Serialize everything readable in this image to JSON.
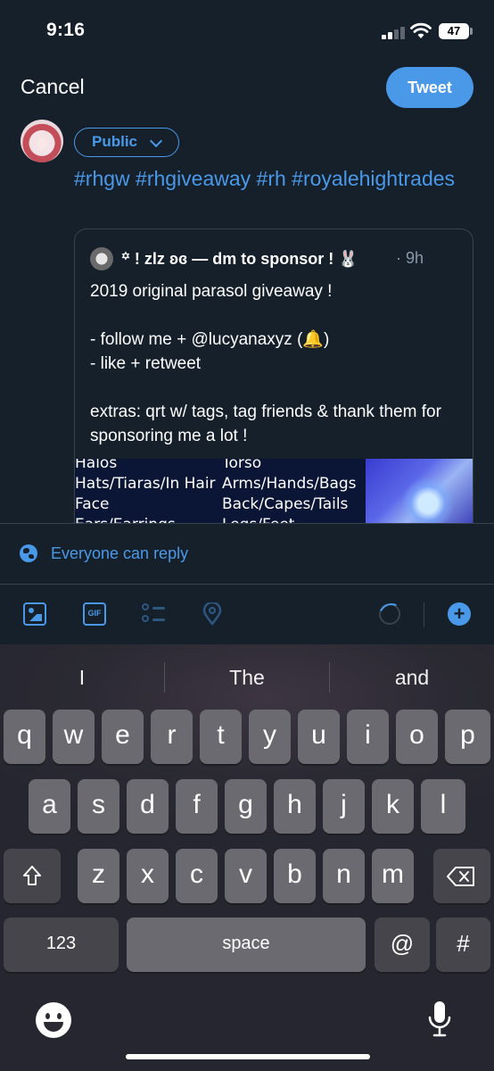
{
  "status_bar": {
    "time": "9:16",
    "battery": "47"
  },
  "header": {
    "cancel_label": "Cancel",
    "tweet_label": "Tweet"
  },
  "composer": {
    "audience_label": "Public",
    "hashtags": "#rhgw #rhgiveaway #rh #royalehightrades"
  },
  "quote": {
    "author": "꙳ ! zlz ʚɞ — dm to sponsor ! 🐰",
    "time": "· 9h",
    "body": "2019 original parasol giveaway !\n\n- follow me + @lucyanaxyz (🔔)\n- like + retweet\n\nextras: qrt w/ tags, tag friends & thank them for sponsoring me a lot !",
    "media_left": "Halos\nHats/Tiaras/In Hair\nFace\nEars/Earrings",
    "media_right": "Torso\nArms/Hands/Bags\nBack/Capes/Tails\nLegs/Feet"
  },
  "reply_setting": "Everyone can reply",
  "toolbar": {
    "icons": [
      "image-icon",
      "gif-icon",
      "poll-icon",
      "location-icon",
      "character-count-ring",
      "add-thread-icon"
    ],
    "accent": "#4a99e9"
  },
  "keyboard": {
    "suggestions": [
      "I",
      "The",
      "and"
    ],
    "row1": [
      "q",
      "w",
      "e",
      "r",
      "t",
      "y",
      "u",
      "i",
      "o",
      "p"
    ],
    "row2": [
      "a",
      "s",
      "d",
      "f",
      "g",
      "h",
      "j",
      "k",
      "l"
    ],
    "row3": [
      "z",
      "x",
      "c",
      "v",
      "b",
      "n",
      "m"
    ],
    "numbers_label": "123",
    "space_label": "space",
    "at_label": "@",
    "hash_label": "#"
  }
}
